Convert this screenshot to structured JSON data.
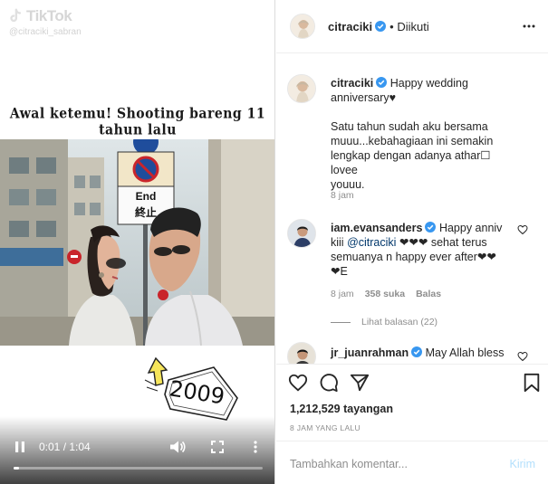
{
  "video": {
    "watermark_brand": "TikTok",
    "watermark_handle": "@citraciki_sabran",
    "caption": "Awal ketemu! Shooting bareng 11 tahun lalu",
    "sign_text_1": "End",
    "sign_text_2": "終止",
    "sticker_year": "2009",
    "time": "0:01 / 1:04",
    "progress": 0.02
  },
  "header": {
    "username": "citraciki",
    "follow_status": "• Diikuti"
  },
  "caption_comment": {
    "username": "citraciki",
    "text_line1": "Happy wedding",
    "text_line2": "anniversary♥",
    "text_line3": "Satu tahun sudah aku bersama",
    "text_line4": "muuu...kebahagiaan ini semakin",
    "text_line5": "lengkap dengan adanya athar☐ lovee",
    "text_line6": "youuu.",
    "time": "8 jam"
  },
  "comments": [
    {
      "username": "iam.evansanders",
      "text_a": "Happy anniv",
      "text_b": "kiii",
      "mention": "@citraciki",
      "text_c": "❤❤❤ sehat terus",
      "text_d": "semuanya n happy ever after❤❤",
      "text_e": "❤E",
      "time": "8 jam",
      "likes": "358 suka",
      "reply": "Balas",
      "view_replies": "Lihat balasan (22)"
    },
    {
      "username": "jr_juanrahman",
      "text_a": "May Allah bless"
    }
  ],
  "stats": {
    "views": "1,212,529 tayangan",
    "time_ago": "8 JAM YANG LALU"
  },
  "add_comment": {
    "placeholder": "Tambahkan komentar...",
    "post_label": "Kirim"
  },
  "colors": {
    "verified": "#3897f0",
    "link": "#00376b",
    "muted": "#8e8e8e",
    "post_disabled": "#b2dffc"
  }
}
